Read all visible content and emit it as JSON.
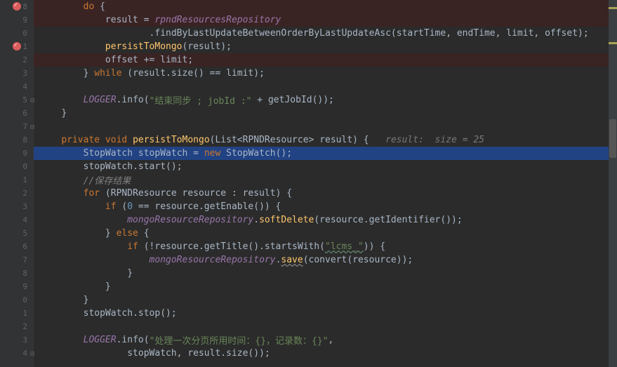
{
  "line_numbers": [
    "8",
    "9",
    "0",
    "1",
    "2",
    "3",
    "4",
    "5",
    "6",
    "7",
    "8",
    "9",
    "0",
    "1",
    "2",
    "3",
    "4",
    "5",
    "6",
    "7",
    "8",
    "9",
    "0",
    "1",
    "2",
    "3",
    "4"
  ],
  "code": {
    "l0": {
      "indent": "        ",
      "kw": "do",
      "post": " {"
    },
    "l1": {
      "indent": "            ",
      "lhs": "result",
      "op": " = ",
      "rhs": "rpndResourcesRepository"
    },
    "l2": {
      "indent": "                    ",
      "dot": ".",
      "fn": "findByLastUpdateBetweenOrderByLastUpdateAsc",
      "args": "(startTime, endTime, limit, offset);"
    },
    "l3": {
      "indent": "            ",
      "fn": "persistToMongo",
      "args": "(result);"
    },
    "l4": {
      "indent": "            ",
      "lhs": "offset",
      "op": " += ",
      "rhs": "limit",
      ";": ";"
    },
    "l5": {
      "indent": "        ",
      "post": "} ",
      "kw": "while",
      "cond": " (result.size() == limit);"
    },
    "l6": {
      "indent": ""
    },
    "l7": {
      "indent": "        ",
      "obj": "LOGGER",
      "dot": ".",
      "fn": "info",
      "open": "(",
      "str": "\"结束同步 ; jobId :\"",
      "rest": " + getJobId());"
    },
    "l8": {
      "indent": "    ",
      "close": "}"
    },
    "l9": {
      "indent": ""
    },
    "l10": {
      "indent": "    ",
      "kw1": "private",
      "sp1": " ",
      "kw2": "void",
      "sp2": " ",
      "fn": "persistToMongo",
      "args": "(List<RPNDResource> result) {",
      "hint": "   result:  size = 25"
    },
    "l11": {
      "indent": "        ",
      "type": "StopWatch",
      "sp": " ",
      "var": "stopWatch",
      "op": " = ",
      "kw": "new",
      "sp2": " ",
      "ctor": "StopWatch",
      "rest": "();"
    },
    "l12": {
      "indent": "        ",
      "var": "stopWatch",
      "dot": ".",
      "fn": "start",
      "rest": "();"
    },
    "l13": {
      "indent": "        ",
      "com": "//保存结果"
    },
    "l14": {
      "indent": "        ",
      "kw": "for",
      "rest": " (RPNDResource resource : result) {"
    },
    "l15": {
      "indent": "            ",
      "kw": "if",
      "open": " (",
      "num": "0",
      "rest": " == resource.getEnable()) {"
    },
    "l16": {
      "indent": "                ",
      "obj": "mongoResourceRepository",
      "dot": ".",
      "fn": "softDelete",
      "rest": "(resource.getIdentifier());"
    },
    "l17": {
      "indent": "            ",
      "close": "} ",
      "kw": "else",
      "rest": " {"
    },
    "l18": {
      "indent": "                ",
      "kw": "if",
      "open": " (!resource.getTitle().startsWith(",
      "str": "\"lcms_\"",
      "rest": ")) {"
    },
    "l19": {
      "indent": "                    ",
      "obj": "mongoResourceRepository",
      "dot": ".",
      "fn": "save",
      "rest": "(convert(resource));"
    },
    "l20": {
      "indent": "                ",
      "close": "}"
    },
    "l21": {
      "indent": "            ",
      "close": "}"
    },
    "l22": {
      "indent": "        ",
      "close": "}"
    },
    "l23": {
      "indent": "        ",
      "var": "stopWatch",
      "dot": ".",
      "fn": "stop",
      "rest": "();"
    },
    "l24": {
      "indent": ""
    },
    "l25": {
      "indent": "        ",
      "obj": "LOGGER",
      "dot": ".",
      "fn": "info",
      "open": "(",
      "str": "\"处理一次分页所用时间：{}，记录数：{}\"",
      "rest": ","
    },
    "l26": {
      "indent": "                ",
      "args": "stopWatch, result.size());"
    }
  },
  "breakpoints": [
    0,
    3
  ],
  "current_line": 11,
  "debug_hint": {
    "label": "result:",
    "value": "size = 25"
  }
}
